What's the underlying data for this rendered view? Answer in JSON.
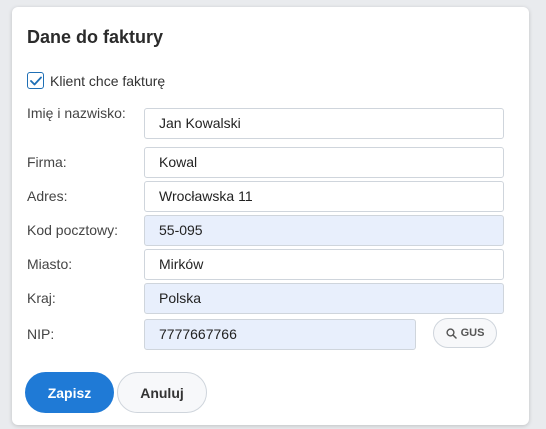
{
  "dialog": {
    "title": "Dane do faktury",
    "invoice_checkbox": {
      "label": "Klient chce fakturę",
      "checked": true
    },
    "fields": {
      "name": {
        "label": "Imię i nazwisko:",
        "value": "Jan Kowalski"
      },
      "company": {
        "label": "Firma:",
        "value": "Kowal"
      },
      "address": {
        "label": "Adres:",
        "value": "Wrocławska 11"
      },
      "postal_code": {
        "label": "Kod pocztowy:",
        "value": "55-095"
      },
      "city": {
        "label": "Miasto:",
        "value": "Mirków"
      },
      "country": {
        "label": "Kraj:",
        "value": "Polska"
      },
      "nip": {
        "label": "NIP:",
        "value": "7777667766"
      }
    },
    "gus_button": {
      "label": "GUS",
      "icon": "search-icon"
    },
    "save_label": "Zapisz",
    "cancel_label": "Anuluj"
  },
  "colors": {
    "primary": "#1f7ad6",
    "autofill_bg": "#e8effc",
    "border": "#cfd5dc"
  }
}
